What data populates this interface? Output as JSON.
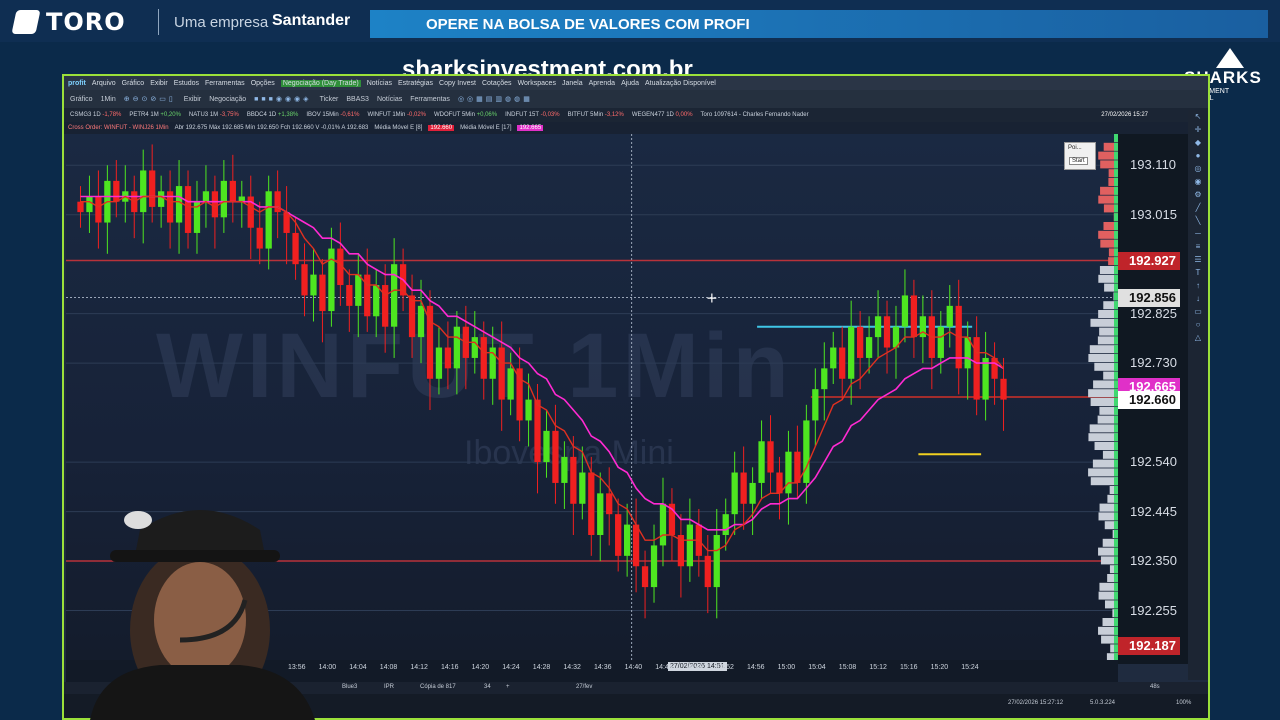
{
  "banner": {
    "brand": "TORO",
    "company": "Uma empresa",
    "partner": "Santander",
    "promo": "OPERE NA BOLSA DE VALORES COM PROFI"
  },
  "overlay": {
    "site_url": "sharksinvestment.com.br",
    "school_logo": "SHARKS",
    "school_sub": "INVESTMENT SCHOOL"
  },
  "app": {
    "logo": "profit",
    "menu": [
      "Arquivo",
      "Gráfico",
      "Exibir",
      "Estudos",
      "Ferramentas",
      "Opções",
      "Negociação (Day Trade)",
      "Notícias",
      "Estratégias",
      "Copy Invest",
      "Cotações",
      "Workspaces",
      "Janela",
      "Aprenda",
      "Ajuda",
      "Atualização Disponível"
    ],
    "toolbar": {
      "grafico": "Gráfico",
      "interval": "1Min",
      "exibir": "Exibir",
      "negociacao": "Negociação",
      "ticker": "Ticker",
      "ticker_value": "BBAS3",
      "noticias": "Notícias",
      "ferramentas": "Ferramentas"
    },
    "tickers": [
      {
        "sym": "CSMG3 1D",
        "chg": "-1,78%",
        "dir": "neg"
      },
      {
        "sym": "PETR4 1M",
        "chg": "+0,20%",
        "dir": "pos"
      },
      {
        "sym": "NATU3 1M",
        "chg": "-3,75%",
        "dir": "neg"
      },
      {
        "sym": "BBDC4 1D",
        "chg": "+1,38%",
        "dir": "pos"
      },
      {
        "sym": "IBOV 15Min",
        "chg": "-0,61%",
        "dir": "neg"
      },
      {
        "sym": "WINFUT 1Min",
        "chg": "-0,02%",
        "dir": "neg"
      },
      {
        "sym": "WDOFUT 5Min",
        "chg": "+0,06%",
        "dir": "pos"
      },
      {
        "sym": "INDFUT 15T",
        "chg": "-0,03%",
        "dir": "neg"
      },
      {
        "sym": "BITFUT 5Min",
        "chg": "-3,12%",
        "dir": "neg"
      },
      {
        "sym": "WEGEN477 1D",
        "chg": "0,00%",
        "dir": "neg"
      },
      {
        "sym": "Toro",
        "chg": "1097614 - Charles Fernando Nader",
        "dir": "none"
      }
    ],
    "datetime": "27/02/2026 15:27",
    "subbar": {
      "order": "Cross Order: WINFUT - WINJ26 1Min",
      "ohlc": "Abr 192.675 Máx 192.685 Mín 192.650 Fch 192.660 V -0,01% A 192.683",
      "mm8_label": "Média Móvel E [8]",
      "mm8_value": "192.660",
      "mm17_label": "Média Móvel E [17]",
      "mm17_value": "192.665"
    },
    "popup": {
      "title": "Poi...",
      "button": "Start"
    },
    "bottom_tabs": [
      "Blue3",
      "IPR",
      "Cópia de 817",
      "34",
      "+"
    ],
    "status_time": "27/02/2026 15:27:12",
    "status_version": "5.0.3.224",
    "zoom": "100%",
    "timer": "48s",
    "date_label": "27/fev"
  },
  "chart_data": {
    "type": "candlestick",
    "watermark": "WINFUT 1Min",
    "watermark_sub": "Ibovespa Mini",
    "y_ticks": [
      193.11,
      193.015,
      192.825,
      192.73,
      192.54,
      192.445,
      192.35,
      192.255
    ],
    "ylim": [
      192.16,
      193.17
    ],
    "x_ticks": [
      "13:56",
      "14:00",
      "14:04",
      "14:08",
      "14:12",
      "14:16",
      "14:20",
      "14:24",
      "14:28",
      "14:32",
      "14:36",
      "14:40",
      "14:44",
      "14:48",
      "14:52",
      "14:56",
      "15:00",
      "15:04",
      "15:08",
      "15:12",
      "15:16",
      "15:20",
      "15:24"
    ],
    "crosshair_time": "27/02/2026 14:51",
    "crosshair_price": 192.856,
    "last_price": 192.66,
    "tags": {
      "high": "192.927",
      "cross": "192.856",
      "mm17": "192.665",
      "last": "192.660",
      "low": "192.187"
    },
    "closes": [
      193.02,
      193.05,
      193.0,
      193.08,
      193.04,
      193.06,
      193.02,
      193.1,
      193.03,
      193.06,
      193.0,
      193.07,
      192.98,
      193.04,
      193.06,
      193.01,
      193.08,
      193.04,
      193.05,
      192.99,
      192.95,
      193.06,
      193.02,
      192.98,
      192.92,
      192.86,
      192.9,
      192.83,
      192.95,
      192.88,
      192.84,
      192.9,
      192.82,
      192.88,
      192.8,
      192.92,
      192.86,
      192.78,
      192.84,
      192.7,
      192.76,
      192.72,
      192.8,
      192.74,
      192.78,
      192.7,
      192.76,
      192.66,
      192.72,
      192.62,
      192.66,
      192.54,
      192.6,
      192.5,
      192.55,
      192.46,
      192.52,
      192.4,
      192.48,
      192.44,
      192.36,
      192.42,
      192.34,
      192.3,
      192.38,
      192.46,
      192.4,
      192.34,
      192.42,
      192.36,
      192.3,
      192.4,
      192.44,
      192.52,
      192.46,
      192.5,
      192.58,
      192.52,
      192.48,
      192.56,
      192.5,
      192.62,
      192.68,
      192.72,
      192.76,
      192.7,
      192.8,
      192.74,
      192.78,
      192.82,
      192.76,
      192.8,
      192.86,
      192.78,
      192.82,
      192.74,
      192.8,
      192.84,
      192.72,
      192.78,
      192.66,
      192.74,
      192.7,
      192.66
    ],
    "mm8": [
      193.04,
      193.04,
      193.03,
      193.04,
      193.04,
      193.05,
      193.04,
      193.05,
      193.05,
      193.05,
      193.04,
      193.04,
      193.03,
      193.03,
      193.04,
      193.03,
      193.04,
      193.04,
      193.04,
      193.03,
      193.02,
      193.03,
      193.03,
      193.02,
      193.0,
      192.97,
      192.95,
      192.92,
      192.93,
      192.92,
      192.9,
      192.9,
      192.88,
      192.88,
      192.86,
      192.87,
      192.87,
      192.85,
      192.85,
      192.81,
      192.8,
      192.78,
      192.78,
      192.77,
      192.77,
      192.75,
      192.75,
      192.73,
      192.73,
      192.7,
      192.69,
      192.65,
      192.64,
      192.61,
      192.6,
      192.57,
      192.56,
      192.52,
      192.51,
      192.49,
      192.46,
      192.45,
      192.42,
      192.39,
      192.39,
      192.4,
      192.4,
      192.39,
      192.39,
      192.39,
      192.37,
      192.37,
      192.38,
      192.41,
      192.42,
      192.44,
      192.47,
      192.48,
      192.48,
      192.5,
      192.5,
      192.53,
      192.57,
      192.61,
      192.65,
      192.66,
      192.69,
      192.7,
      192.72,
      192.74,
      192.75,
      192.76,
      192.78,
      192.78,
      192.79,
      192.78,
      192.78,
      192.79,
      192.78,
      192.78,
      192.75,
      192.75,
      192.74,
      192.72
    ],
    "mm17": [
      193.05,
      193.05,
      193.05,
      193.05,
      193.05,
      193.05,
      193.05,
      193.05,
      193.05,
      193.05,
      193.05,
      193.05,
      193.04,
      193.04,
      193.04,
      193.04,
      193.04,
      193.04,
      193.04,
      193.04,
      193.03,
      193.03,
      193.03,
      193.02,
      193.01,
      193.0,
      192.99,
      192.97,
      192.97,
      192.96,
      192.94,
      192.94,
      192.92,
      192.91,
      192.9,
      192.9,
      192.89,
      192.87,
      192.87,
      192.85,
      192.84,
      192.82,
      192.82,
      192.81,
      192.8,
      192.79,
      192.78,
      192.77,
      192.76,
      192.74,
      192.73,
      192.71,
      192.7,
      192.67,
      192.66,
      192.64,
      192.62,
      192.59,
      192.58,
      192.56,
      192.53,
      192.52,
      192.49,
      192.47,
      192.46,
      192.46,
      192.45,
      192.43,
      192.43,
      192.42,
      192.41,
      192.41,
      192.41,
      192.42,
      192.42,
      192.43,
      192.45,
      192.46,
      192.46,
      192.47,
      192.47,
      192.49,
      192.51,
      192.54,
      192.57,
      192.58,
      192.61,
      192.62,
      192.64,
      192.66,
      192.67,
      192.68,
      192.7,
      192.71,
      192.72,
      192.72,
      192.73,
      192.74,
      192.74,
      192.74,
      192.73,
      192.73,
      192.73,
      192.72
    ],
    "levels": {
      "red_high": 192.927,
      "red_low": 192.35,
      "cyan": 192.8,
      "yellow": 192.555,
      "red_mid": 192.665
    }
  }
}
